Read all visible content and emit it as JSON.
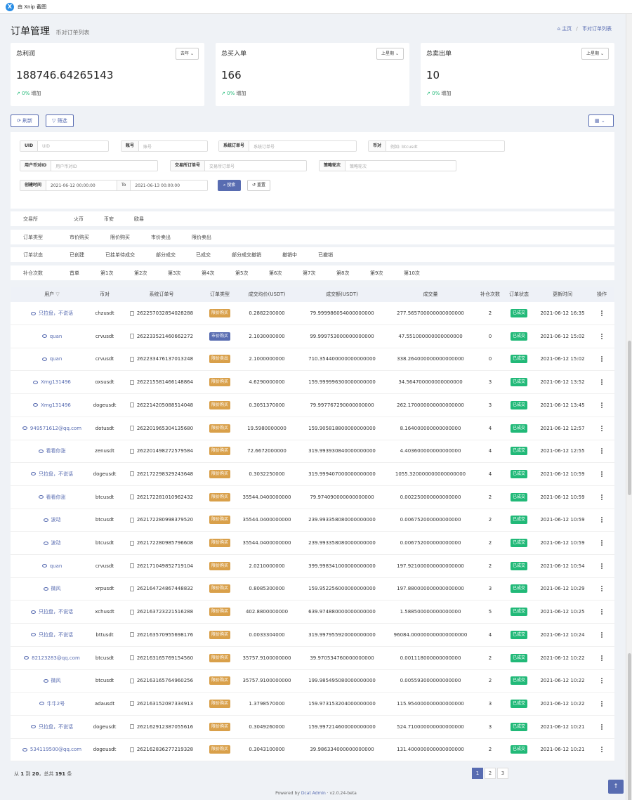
{
  "window": {
    "title": "由 Xnip 截图"
  },
  "header": {
    "title": "订单管理",
    "subtitle": "币对订单列表",
    "crumb_home": "主页",
    "crumb_current": "币对订单列表"
  },
  "cards": [
    {
      "title": "总利润",
      "period": "去年",
      "value": "188746.64265143",
      "trend_pct": "0%",
      "trend_label": "增加"
    },
    {
      "title": "总买入单",
      "period": "上星期",
      "value": "166",
      "trend_pct": "0%",
      "trend_label": "增加"
    },
    {
      "title": "总卖出单",
      "period": "上星期",
      "value": "10",
      "trend_pct": "0%",
      "trend_label": "增加"
    }
  ],
  "toolbar": {
    "refresh": "刷新",
    "filter": "筛选"
  },
  "filters": {
    "uid_label": "UID",
    "uid_placeholder": "UID",
    "account_label": "账号",
    "account_placeholder": "账号",
    "sysorder_label": "系统订单号",
    "sysorder_placeholder": "系统订单号",
    "pair_label": "币对",
    "pair_placeholder": "例如: btcusdt",
    "userexid_label": "用户币对ID",
    "userexid_placeholder": "用户币对ID",
    "exorder_label": "交易所订单号",
    "exorder_placeholder": "交易所订单号",
    "round_label": "策略轮次",
    "round_placeholder": "策略轮次",
    "time_label": "创建时间",
    "time_start": "2021-06-12 00:00:00",
    "time_to": "To",
    "time_end": "2021-06-13 00:00:00",
    "search": "搜索",
    "reset": "重置"
  },
  "categories": [
    {
      "label": "交易所",
      "items": [
        "火币",
        "币安",
        "欧易"
      ]
    },
    {
      "label": "订单类型",
      "items": [
        "市价购买",
        "限价购买",
        "市价卖出",
        "限价卖出"
      ]
    },
    {
      "label": "订单状态",
      "items": [
        "已创建",
        "已挂单待成交",
        "部分成交",
        "已成交",
        "部分成交撤销",
        "撤销中",
        "已撤销"
      ]
    },
    {
      "label": "补仓次数",
      "items": [
        "首单",
        "第1次",
        "第2次",
        "第3次",
        "第4次",
        "第5次",
        "第6次",
        "第7次",
        "第8次",
        "第9次",
        "第10次"
      ]
    }
  ],
  "table": {
    "columns": [
      "用户",
      "币对",
      "系统订单号",
      "订单类型",
      "成交均价(USDT)",
      "成交额(USDT)",
      "成交量",
      "补仓次数",
      "订单状态",
      "更新时间",
      "操作"
    ],
    "rows": [
      {
        "user": "只拉盘，不说话",
        "pair": "chzusdt",
        "order": "262257032854028288",
        "type": "限价购买",
        "type_color": "#d9a04a",
        "price": "0.2882200000",
        "amount": "79.999986054000000000",
        "qty": "277.565700000000000000",
        "cnt": "2",
        "status": "已成交",
        "time": "2021-06-12 16:35"
      },
      {
        "user": "quan",
        "pair": "crvusdt",
        "order": "262233521460662272",
        "type": "市价购买",
        "type_color": "#586cb1",
        "price": "2.1030000000",
        "amount": "99.999753000000000000",
        "qty": "47.551000000000000000",
        "cnt": "0",
        "status": "已成交",
        "time": "2021-06-12 15:02"
      },
      {
        "user": "quan",
        "pair": "crvusdt",
        "order": "262233476137013248",
        "type": "限价卖出",
        "type_color": "#d9a04a",
        "price": "2.1000000000",
        "amount": "710.354400000000000000",
        "qty": "338.264000000000000000",
        "cnt": "0",
        "status": "已成交",
        "time": "2021-06-12 15:02"
      },
      {
        "user": "Xmg131496",
        "pair": "oxsusdt",
        "order": "262215581466148864",
        "type": "限价购买",
        "type_color": "#d9a04a",
        "price": "4.6290000000",
        "amount": "159.999996300000000000",
        "qty": "34.564700000000000000",
        "cnt": "3",
        "status": "已成交",
        "time": "2021-06-12 13:52"
      },
      {
        "user": "Xmg131496",
        "pair": "dogeusdt",
        "order": "262214205088514048",
        "type": "限价购买",
        "type_color": "#d9a04a",
        "price": "0.3051370000",
        "amount": "79.997767290000000000",
        "qty": "262.170000000000000000",
        "cnt": "3",
        "status": "已成交",
        "time": "2021-06-12 13:45"
      },
      {
        "user": "949571612@qq.com",
        "pair": "dotusdt",
        "order": "262201965304135680",
        "type": "限价购买",
        "type_color": "#d9a04a",
        "price": "19.5980000000",
        "amount": "159.905818800000000000",
        "qty": "8.164000000000000000",
        "cnt": "4",
        "status": "已成交",
        "time": "2021-06-12 12:57"
      },
      {
        "user": "看看你涨",
        "pair": "zenusdt",
        "order": "262201498272579584",
        "type": "限价购买",
        "type_color": "#d9a04a",
        "price": "72.6672000000",
        "amount": "319.993930840000000000",
        "qty": "4.403600000000000000",
        "cnt": "4",
        "status": "已成交",
        "time": "2021-06-12 12:55"
      },
      {
        "user": "只拉盘，不说话",
        "pair": "dogeusdt",
        "order": "262172298329243648",
        "type": "限价购买",
        "type_color": "#d9a04a",
        "price": "0.3032250000",
        "amount": "319.999407000000000000",
        "qty": "1055.320000000000000000",
        "cnt": "4",
        "status": "已成交",
        "time": "2021-06-12 10:59"
      },
      {
        "user": "看看你涨",
        "pair": "btcusdt",
        "order": "262172281010962432",
        "type": "限价购买",
        "type_color": "#d9a04a",
        "price": "35544.0400000000",
        "amount": "79.974090000000000000",
        "qty": "0.002250000000000000",
        "cnt": "2",
        "status": "已成交",
        "time": "2021-06-12 10:59"
      },
      {
        "user": "波动",
        "pair": "btcusdt",
        "order": "262172280998379520",
        "type": "限价购买",
        "type_color": "#d9a04a",
        "price": "35544.0400000000",
        "amount": "239.993358080000000000",
        "qty": "0.006752000000000000",
        "cnt": "2",
        "status": "已成交",
        "time": "2021-06-12 10:59"
      },
      {
        "user": "波动",
        "pair": "btcusdt",
        "order": "262172280985796608",
        "type": "限价购买",
        "type_color": "#d9a04a",
        "price": "35544.0400000000",
        "amount": "239.993358080000000000",
        "qty": "0.006752000000000000",
        "cnt": "2",
        "status": "已成交",
        "time": "2021-06-12 10:59"
      },
      {
        "user": "quan",
        "pair": "crvusdt",
        "order": "262171049852719104",
        "type": "限价购买",
        "type_color": "#d9a04a",
        "price": "2.0210000000",
        "amount": "399.998341000000000000",
        "qty": "197.921000000000000000",
        "cnt": "2",
        "status": "已成交",
        "time": "2021-06-12 10:54"
      },
      {
        "user": "微风",
        "pair": "xrpusdt",
        "order": "262164724867448832",
        "type": "限价购买",
        "type_color": "#d9a04a",
        "price": "0.8085300000",
        "amount": "159.952256000000000000",
        "qty": "197.880000000000000000",
        "cnt": "3",
        "status": "已成交",
        "time": "2021-06-12 10:29"
      },
      {
        "user": "只拉盘，不说话",
        "pair": "xchusdt",
        "order": "262163723221516288",
        "type": "限价购买",
        "type_color": "#d9a04a",
        "price": "402.8800000000",
        "amount": "639.974880000000000000",
        "qty": "1.588500000000000000",
        "cnt": "5",
        "status": "已成交",
        "time": "2021-06-12 10:25"
      },
      {
        "user": "只拉盘，不说话",
        "pair": "bttusdt",
        "order": "262163570955698176",
        "type": "限价购买",
        "type_color": "#d9a04a",
        "price": "0.0033304000",
        "amount": "319.997955920000000000",
        "qty": "96084.000000000000000000",
        "cnt": "4",
        "status": "已成交",
        "time": "2021-06-12 10:24"
      },
      {
        "user": "82123283@qq.com",
        "pair": "btcusdt",
        "order": "262163165769154560",
        "type": "限价购买",
        "type_color": "#d9a04a",
        "price": "35757.9100000000",
        "amount": "39.970534760000000000",
        "qty": "0.001118000000000000",
        "cnt": "2",
        "status": "已成交",
        "time": "2021-06-12 10:22"
      },
      {
        "user": "微风",
        "pair": "btcusdt",
        "order": "262163165764960256",
        "type": "限价购买",
        "type_color": "#d9a04a",
        "price": "35757.9100000000",
        "amount": "199.985495080000000000",
        "qty": "0.005593000000000000",
        "cnt": "2",
        "status": "已成交",
        "time": "2021-06-12 10:22"
      },
      {
        "user": "牛牛2号",
        "pair": "adausdt",
        "order": "262163152087334913",
        "type": "限价购买",
        "type_color": "#d9a04a",
        "price": "1.3798570000",
        "amount": "159.973153204000000000",
        "qty": "115.954000000000000000",
        "cnt": "3",
        "status": "已成交",
        "time": "2021-06-12 10:22"
      },
      {
        "user": "只拉盘，不说话",
        "pair": "dogeusdt",
        "order": "262162912387055616",
        "type": "限价购买",
        "type_color": "#d9a04a",
        "price": "0.3049260000",
        "amount": "159.997214600000000000",
        "qty": "524.710000000000000000",
        "cnt": "3",
        "status": "已成交",
        "time": "2021-06-12 10:21"
      },
      {
        "user": "534119500@qq.com",
        "pair": "dogeusdt",
        "order": "262162836277219328",
        "type": "限价购买",
        "type_color": "#d9a04a",
        "price": "0.3043100000",
        "amount": "39.986334000000000000",
        "qty": "131.400000000000000000",
        "cnt": "2",
        "status": "已成交",
        "time": "2021-06-12 10:21"
      }
    ]
  },
  "footer": {
    "info_prefix": "从",
    "from": "1",
    "to_word": "到",
    "to": "20",
    "total_word": "，总共",
    "total": "191",
    "unit": "条",
    "pages": [
      "1",
      "2",
      "3"
    ],
    "powered_prefix": "Powered by",
    "powered_link": "Dcat Admin",
    "version": "· v2.0.24-beta",
    "back_top": "↑"
  },
  "colors": {
    "primary": "#586cb1",
    "success": "#21b978",
    "warning": "#d9a04a"
  }
}
